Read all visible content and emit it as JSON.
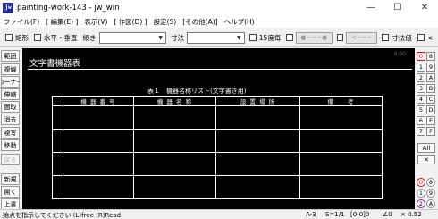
{
  "window": {
    "app_icon_text": "jw",
    "title": "painting-work-143 - jw_win",
    "controls": [
      "—",
      "☐",
      "✕"
    ]
  },
  "menu": [
    "ファイル(F)",
    "[ 編集(E) ]",
    "表示(V)",
    "[ 作図(D) ]",
    "設定(S)",
    "[その他(A)]",
    "ヘルプ(H)"
  ],
  "toolbar": {
    "rect_label": "矩形",
    "hv_label": "水平・垂直",
    "tilt_label": "傾き",
    "dim_label": "寸法",
    "deg15_label": "15度毎",
    "dot_btn": "●−−−●",
    "arrow_btn": "<−−−",
    "dimvalue_label": "寸法値",
    "lt_label": "<"
  },
  "left_tools": [
    "範囲",
    "複線",
    "コーナー",
    "伸縮",
    "面取",
    "消去",
    "複写",
    "移動",
    "戻る",
    "新規",
    "開く",
    "上書"
  ],
  "drawing": {
    "sheet_title": "文字書機器表",
    "faint_text": "0.60",
    "table_caption": "表１　機器名称リスト(文字書き用)",
    "headers": [
      "機 器 番 号",
      "機 器 名 称",
      "設 置 場 所",
      "備　　考"
    ]
  },
  "right_tools": {
    "row_labels": [
      [
        "0",
        "8"
      ],
      [
        "1",
        "9"
      ],
      [
        "2",
        "A"
      ],
      [
        "3",
        "B"
      ],
      [
        "4",
        "C"
      ],
      [
        "5",
        "D"
      ],
      [
        "6",
        "E"
      ],
      [
        "7",
        "F"
      ]
    ],
    "all_label": "All",
    "x_label": "✕",
    "bottom": [
      [
        "0",
        "8"
      ],
      [
        "1",
        "9"
      ],
      [
        "2",
        "A"
      ]
    ]
  },
  "status": {
    "message": "始点を指示してください (L)free (R)Read",
    "paper": "A-3",
    "scale": "S=1/1",
    "layer": "[0-0]0",
    "angle": "∠0",
    "zoom": "× 0.52"
  }
}
